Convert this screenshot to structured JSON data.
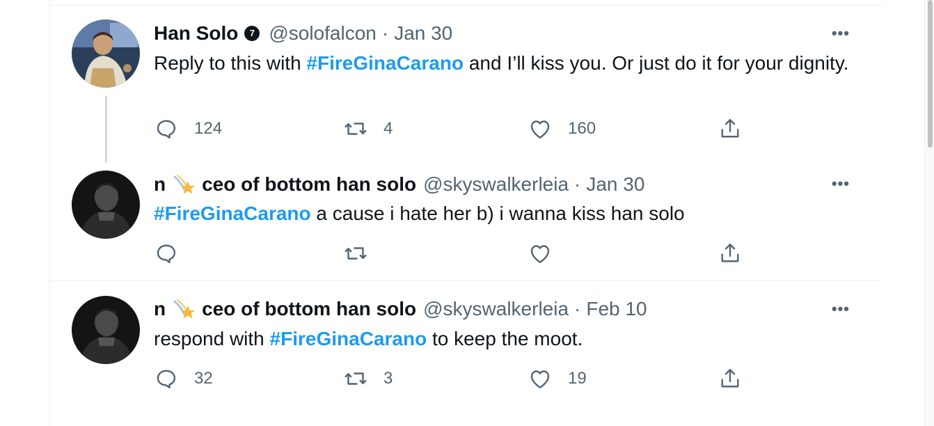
{
  "tweets": [
    {
      "name": "Han Solo",
      "badge": "7",
      "handle": "@solofalcon",
      "separator": "·",
      "time": "Jan 30",
      "more": "•••",
      "text_before": "Reply to this with ",
      "hashtag": "#FireGinaCarano",
      "text_after": " and I’ll kiss you. Or just do it for your dignity.",
      "replies": "124",
      "retweets": "4",
      "likes": "160"
    },
    {
      "name_prefix": "n",
      "name": "ceo of bottom han solo",
      "handle": "@skyswalkerleia",
      "separator": "·",
      "time": "Jan 30",
      "more": "•••",
      "text_before": "",
      "hashtag": "#FireGinaCarano",
      "text_after": " a cause i hate her b) i wanna kiss han solo",
      "replies": "",
      "retweets": "",
      "likes": ""
    },
    {
      "name_prefix": "n",
      "name": "ceo of bottom han solo",
      "handle": "@skyswalkerleia",
      "separator": "·",
      "time": "Feb 10",
      "more": "•••",
      "text_before": "respond with ",
      "hashtag": "#FireGinaCarano",
      "text_after": " to keep the moot.",
      "replies": "32",
      "retweets": "3",
      "likes": "19"
    }
  ],
  "icons": {
    "reply": "reply-icon",
    "retweet": "retweet-icon",
    "like": "heart-icon",
    "share": "share-icon",
    "verified": "verified-badge-icon",
    "emoji": "shooting-star-emoji"
  },
  "colors": {
    "hashtag": "#1d9bf0",
    "secondary_text": "#536471",
    "primary_text": "#0f1419",
    "border": "#ebeef0"
  }
}
